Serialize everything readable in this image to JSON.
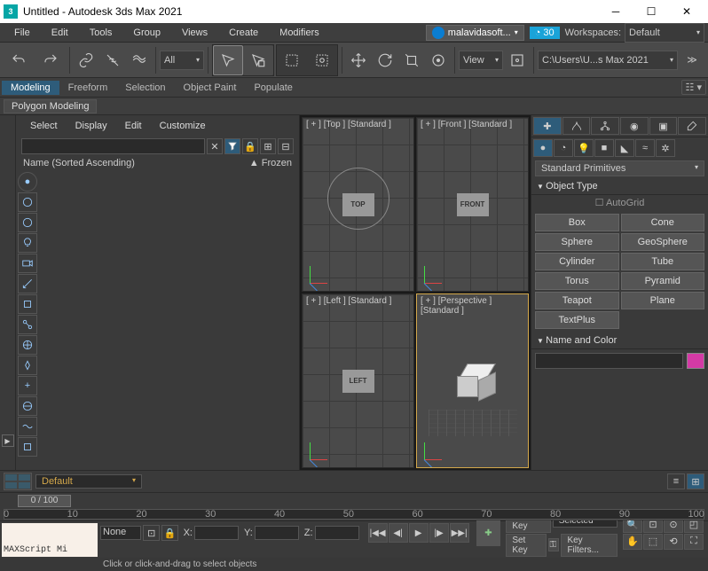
{
  "title": "Untitled - Autodesk 3ds Max 2021",
  "app_icon_text": "3",
  "menubar": [
    "File",
    "Edit",
    "Tools",
    "Group",
    "Views",
    "Create",
    "Modifiers"
  ],
  "user_label": "malavidasoft...",
  "time_badge": "30",
  "workspaces_label": "Workspaces:",
  "workspace_current": "Default",
  "toolbar": {
    "filter_dd": "All",
    "view_dd": "View",
    "path": "C:\\Users\\U...s Max 2021"
  },
  "ribbon_tabs": [
    "Modeling",
    "Freeform",
    "Selection",
    "Object Paint",
    "Populate"
  ],
  "sub_ribbon": "Polygon Modeling",
  "scene": {
    "tabs": [
      "Select",
      "Display",
      "Edit",
      "Customize"
    ],
    "col_name": "Name (Sorted Ascending)",
    "col_frozen": "▲ Frozen"
  },
  "viewports": {
    "top": "[ + ] [Top ] [Standard ]",
    "front": "[ + ] [Front ] [Standard ]",
    "left": "[ + ] [Left ] [Standard ]",
    "persp": "[ + ] [Perspective ] [Standard ]",
    "labels": {
      "top": "TOP",
      "front": "FRONT",
      "left": "LEFT"
    }
  },
  "cmd": {
    "category": "Standard Primitives",
    "rollout_type": "Object Type",
    "autogrid": "AutoGrid",
    "buttons": [
      "Box",
      "Cone",
      "Sphere",
      "GeoSphere",
      "Cylinder",
      "Tube",
      "Torus",
      "Pyramid",
      "Teapot",
      "Plane",
      "TextPlus",
      ""
    ],
    "rollout_name": "Name and Color",
    "color": "#d43aa5"
  },
  "layer": {
    "current": "Default"
  },
  "timeline": {
    "slider": "0 / 100",
    "ticks": [
      "0",
      "10",
      "20",
      "30",
      "40",
      "50",
      "60",
      "70",
      "80",
      "90",
      "100"
    ]
  },
  "status": {
    "script": "MAXScript Mi",
    "none_label": "None",
    "x": "X:",
    "y": "Y:",
    "z": "Z:",
    "prompt": "Click or click-and-drag to select objects",
    "autokey": "Auto Key",
    "setkey": "Set Key",
    "selected": "Selected",
    "keyfilters": "Key Filters..."
  }
}
